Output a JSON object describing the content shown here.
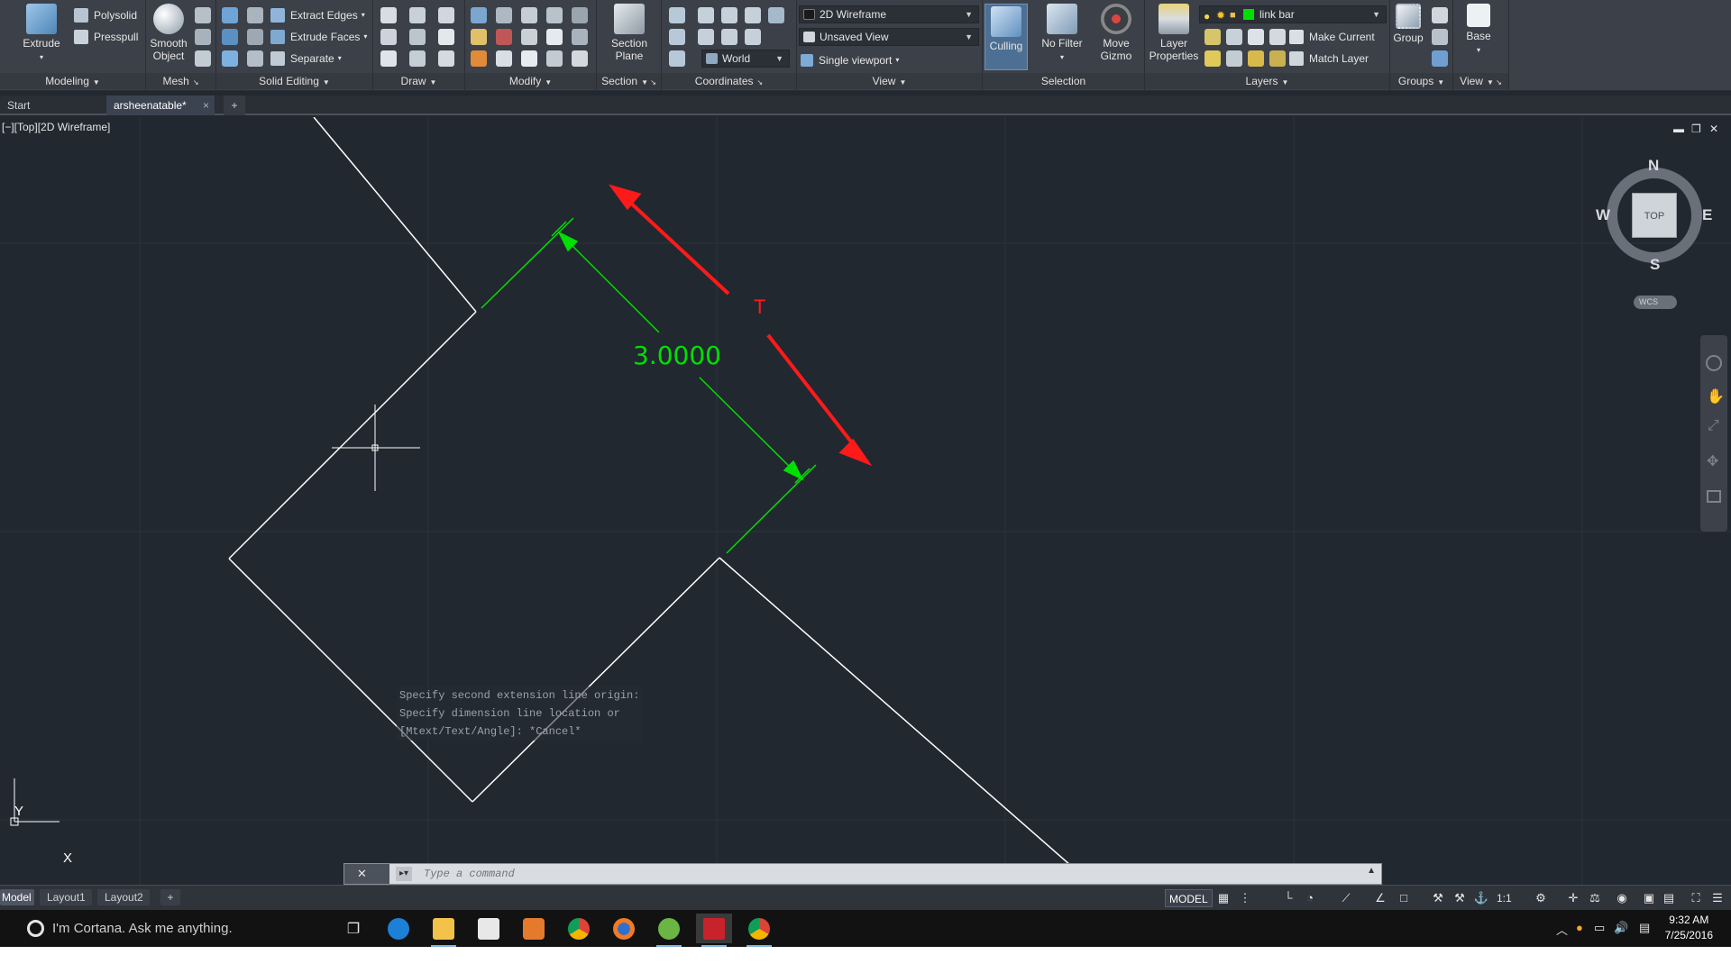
{
  "ribbon": {
    "modeling": {
      "title": "Modeling",
      "extrude": "Extrude",
      "polysolid": "Polysolid",
      "presspull": "Presspull"
    },
    "mesh": {
      "title": "Mesh",
      "smooth_object": "Smooth Object"
    },
    "solid_editing": {
      "title": "Solid Editing",
      "extract_edges": "Extract Edges",
      "extrude_faces": "Extrude Faces",
      "separate": "Separate"
    },
    "draw": {
      "title": "Draw"
    },
    "modify": {
      "title": "Modify"
    },
    "section": {
      "title": "Section",
      "section_plane": "Section Plane"
    },
    "coordinates": {
      "title": "Coordinates",
      "world": "World"
    },
    "view": {
      "title": "View",
      "visual_style": "2D Wireframe",
      "named_view": "Unsaved View",
      "viewport_config": "Single viewport"
    },
    "selection": {
      "title": "Selection",
      "culling": "Culling",
      "no_filter": "No Filter",
      "move_gizmo": "Move Gizmo"
    },
    "layers": {
      "title": "Layers",
      "layer_properties": "Layer Properties",
      "current_layer": "link bar",
      "make_current": "Make Current",
      "match_layer": "Match Layer"
    },
    "groups": {
      "title": "Groups",
      "group": "Group"
    },
    "view2": {
      "title": "View",
      "base": "Base"
    }
  },
  "file_tabs": {
    "start": "Start",
    "active": "arsheenatable*",
    "close": "×",
    "new": "+"
  },
  "viewport": {
    "label": "[−][Top][2D Wireframe]",
    "controls": {
      "minimize": "▬",
      "restore": "❐",
      "close": "✕"
    },
    "viewcube": {
      "n": "N",
      "s": "S",
      "e": "E",
      "w": "W",
      "face": "TOP",
      "wcs": "WCS"
    },
    "ucs": {
      "x": "X",
      "y": "Y"
    },
    "dimension_text": "3.0000",
    "annotation_text": "T"
  },
  "command_history": [
    "Specify second extension line origin:",
    "Specify dimension line location or",
    "[Mtext/Text/Angle]: *Cancel*"
  ],
  "command_line": {
    "placeholder": "Type a command"
  },
  "layout_tabs": [
    "Model",
    "Layout1",
    "Layout2"
  ],
  "layout_add": "+",
  "status_bar": {
    "model": "MODEL",
    "scale": "1:1"
  },
  "taskbar": {
    "cortana": "I'm Cortana. Ask me anything.",
    "time": "9:32 AM",
    "date": "7/25/2016"
  },
  "colors": {
    "canvas": "#212830",
    "dimension": "#00e000",
    "annotation": "#ff1a1a",
    "geometry": "#ffffff"
  }
}
